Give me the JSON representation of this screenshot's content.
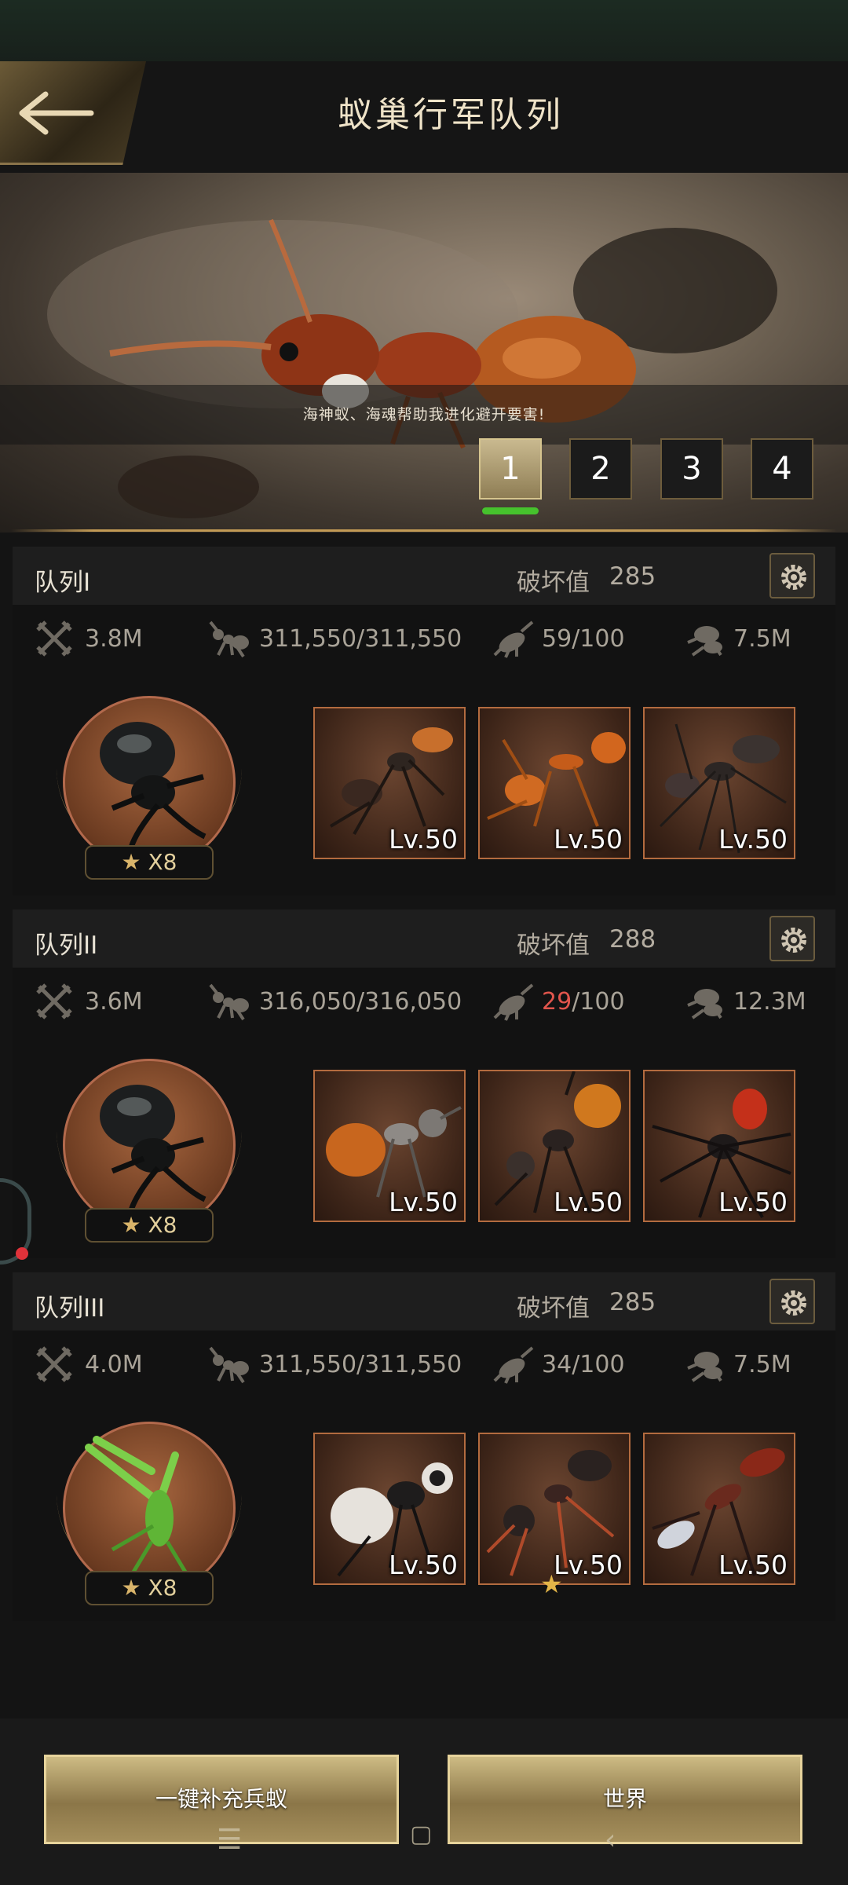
{
  "header": {
    "title": "蚁巢行军队列"
  },
  "banner": {
    "caption": "海神蚁、海魂帮助我进化避开要害!",
    "tabs": [
      "1",
      "2",
      "3",
      "4"
    ],
    "active_tab": "1"
  },
  "squads": [
    {
      "name": "队列I",
      "power_label": "破坏值",
      "power_value": "285",
      "attack": "3.8M",
      "troops": "311,550/311,550",
      "capacity": "59/100",
      "capacity_current": "59",
      "capacity_max": "/100",
      "load": "7.5M",
      "hero_stars": "X8",
      "hero_icon": "stag-beetle",
      "units": [
        {
          "level": "Lv.50",
          "icon": "ant-orange-black"
        },
        {
          "level": "Lv.50",
          "icon": "ant-fire-orange"
        },
        {
          "level": "Lv.50",
          "icon": "ant-long-leg-black"
        }
      ]
    },
    {
      "name": "队列II",
      "power_label": "破坏值",
      "power_value": "288",
      "attack": "3.6M",
      "troops": "316,050/316,050",
      "capacity_current": "29",
      "capacity_max": "/100",
      "load": "12.3M",
      "hero_stars": "X8",
      "hero_icon": "stag-beetle",
      "units": [
        {
          "level": "Lv.50",
          "icon": "ant-amber-abdomen"
        },
        {
          "level": "Lv.50",
          "icon": "ant-black-amber"
        },
        {
          "level": "Lv.50",
          "icon": "spider-red-abdomen"
        }
      ]
    },
    {
      "name": "队列III",
      "power_label": "破坏值",
      "power_value": "285",
      "attack": "4.0M",
      "troops": "311,550/311,550",
      "capacity": "34/100",
      "capacity_current": "34",
      "capacity_max": "/100",
      "load": "7.5M",
      "hero_stars": "X8",
      "hero_icon": "praying-mantis",
      "units": [
        {
          "level": "Lv.50",
          "icon": "ant-white-fuzzy"
        },
        {
          "level": "Lv.50",
          "icon": "ant-black-red"
        },
        {
          "level": "Lv.50",
          "icon": "ant-black-red-long"
        }
      ]
    }
  ],
  "actions": {
    "refill_label": "一键补充兵蚁",
    "world_label": "世界"
  },
  "colors": {
    "accent_gold": "#c29a55",
    "active_indicator": "#46c22d",
    "warning_red": "#e0554c"
  }
}
